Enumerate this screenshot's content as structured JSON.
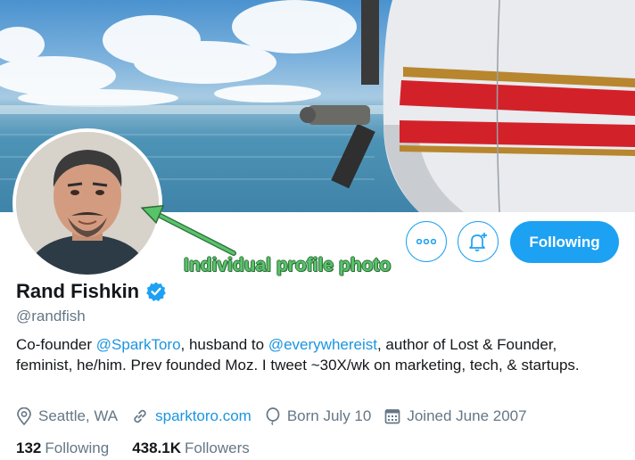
{
  "profile": {
    "name": "Rand Fishkin",
    "handle": "@randfish",
    "verified": true,
    "bio": {
      "part1": "Co-founder ",
      "mention1": "@SparkToro",
      "part2": ", husband to ",
      "mention2": "@everywhereist",
      "part3": ", author of Lost & Founder, feminist, he/him. Prev founded Moz. I tweet ~30X/wk on marketing, tech, & startups."
    },
    "location": "Seattle, WA",
    "website": "sparktoro.com",
    "birthday": "Born July 10",
    "joined": "Joined June 2007",
    "following_count": "132",
    "following_label": "Following",
    "followers_count": "438.1K",
    "followers_label": "Followers"
  },
  "actions": {
    "follow_label": "Following",
    "more_icon": "more-icon",
    "notify_icon": "notification-add-icon"
  },
  "annotation": {
    "text": "Individual profile photo"
  },
  "colors": {
    "accent": "#1da1f2",
    "link": "#1b95e0",
    "muted": "#657786",
    "annotation": "#57c46a"
  }
}
